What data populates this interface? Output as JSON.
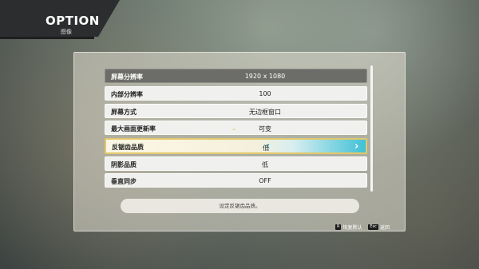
{
  "header": {
    "title": "OPTION",
    "subtitle": "图像"
  },
  "settings": [
    {
      "label": "屏幕分辨率",
      "value": "1920 x 1080"
    },
    {
      "label": "内部分辨率",
      "value": "100"
    },
    {
      "label": "屏幕方式",
      "value": "无边框窗口"
    },
    {
      "label": "最大画面更新率",
      "value": "可变"
    },
    {
      "label": "反锯齿品质",
      "value": "低"
    },
    {
      "label": "阴影品质",
      "value": "低"
    },
    {
      "label": "垂直同步",
      "value": "OFF"
    }
  ],
  "description": "设定反锯齿品质。",
  "footer": {
    "reset_key": "R",
    "reset_label": "恢复默认",
    "back_key": "Esc",
    "back_label": "返回"
  },
  "colors": {
    "accent": "#3fc1d6",
    "highlight_border": "#e2c86a",
    "title_bar": "#2c2d2f"
  },
  "icons": {
    "left": "chevron-left-icon",
    "right": "chevron-right-icon",
    "up": "chevron-up-icon",
    "down": "chevron-down-icon"
  }
}
